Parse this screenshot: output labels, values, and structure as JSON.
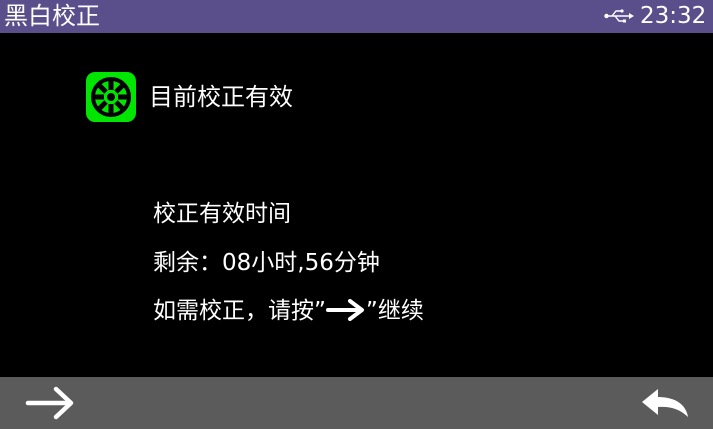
{
  "titlebar": {
    "title": "黑白校正",
    "time": "23:32",
    "usb_icon": "usb-icon"
  },
  "status": {
    "icon": "calibration-valid-icon",
    "icon_color": "#00e600",
    "text": "目前校正有效"
  },
  "info": {
    "line1": "校正有效时间",
    "line2": "剩余：08小时,56分钟",
    "line3_before": "如需校正，请按”",
    "line3_arrow": "arrow-right-icon",
    "line3_after": "”继续"
  },
  "bottombar": {
    "next_icon": "arrow-right-icon",
    "back_icon": "return-icon",
    "bar_color": "#5b5b5b"
  }
}
